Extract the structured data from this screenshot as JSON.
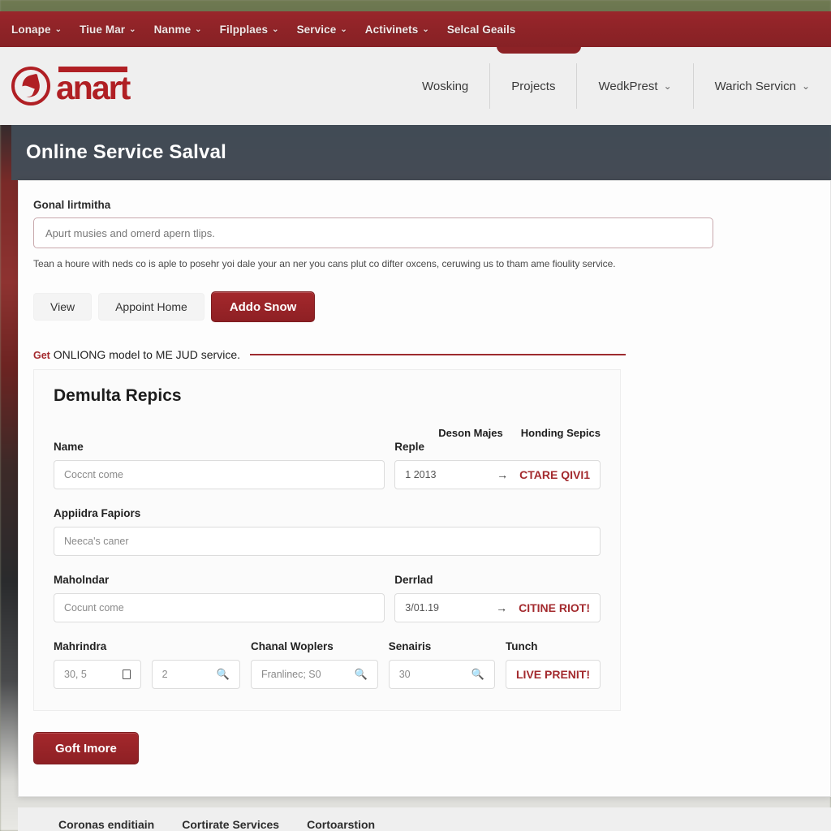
{
  "topnav": {
    "items": [
      {
        "label": "Lonape",
        "caret": "⌄"
      },
      {
        "label": "Tiue Mar",
        "caret": "⌄"
      },
      {
        "label": "Nanme",
        "caret": "⌄"
      },
      {
        "label": "Filpplaes",
        "caret": "⌄"
      },
      {
        "label": "Service",
        "caret": "⌄"
      },
      {
        "label": "Activinets",
        "caret": "⌄"
      },
      {
        "label": "Selcal Geails",
        "caret": ""
      }
    ]
  },
  "brand": {
    "wordmark": "anart",
    "links": [
      {
        "label": "Wosking",
        "caret": ""
      },
      {
        "label": "Projects",
        "caret": ""
      },
      {
        "label": "WedkPrest",
        "caret": "⌄"
      },
      {
        "label": "Warich Servicn",
        "caret": "⌄"
      }
    ]
  },
  "page": {
    "title": "Online Service Salval"
  },
  "goal": {
    "label": "Gonal lirtmitha",
    "value": "Apurt musies and omerd apern tlips.",
    "help": "Tean a houre with neds co is aple to posehr yoi dale your an ner you cans plut co difter oxcens, ceruwing us to tham ame fioulity service."
  },
  "actions": {
    "view": "View",
    "appoint_home": "Appoint Home",
    "addo_snow": "Addo Snow"
  },
  "legend": {
    "lead": "Get",
    "rest": "ONLIONG model to ME JUD service."
  },
  "panel": {
    "title": "Demulta Repics",
    "micro_headers": [
      "Deson Majes",
      "Honding Sepics"
    ],
    "rows": [
      {
        "left_label": "Name",
        "left_value": "Coccnt come",
        "right_label": "Reple",
        "right_value": "1 2013",
        "right_arrow": "→",
        "right_cta": "CTARE QIVI1"
      },
      {
        "left_label": "Appiidra Fapiors",
        "left_value": "Neeca's caner"
      },
      {
        "left_label": "Maholndar",
        "left_value": "Cocunt come",
        "right_label": "Derrlad",
        "right_value": "3/01.19",
        "right_arrow": "→",
        "right_cta": "CITINE RIOT!"
      }
    ],
    "quad": {
      "labels": [
        "Mahrindra",
        "",
        "Chanal Woplers",
        "Senairis",
        "Tunch"
      ],
      "cells": [
        {
          "value": "30, 5",
          "icon": "square-icon"
        },
        {
          "value": "2",
          "icon": "search-icon"
        },
        {
          "value": "Franlinec; S0",
          "icon": "search-icon"
        },
        {
          "value": "30",
          "icon": "search-icon"
        },
        {
          "value": "LIVE PRENIT!",
          "icon": ""
        }
      ]
    }
  },
  "submit": {
    "label": "Goft Imore"
  },
  "footer": {
    "links": [
      "Coronas enditiain",
      "Cortirate Services",
      "Cortoarstion"
    ]
  },
  "colors": {
    "brand_red": "#b01f24",
    "nav_red": "#8e2327",
    "title_band": "#424d58",
    "cta_red": "#a32a2e"
  }
}
